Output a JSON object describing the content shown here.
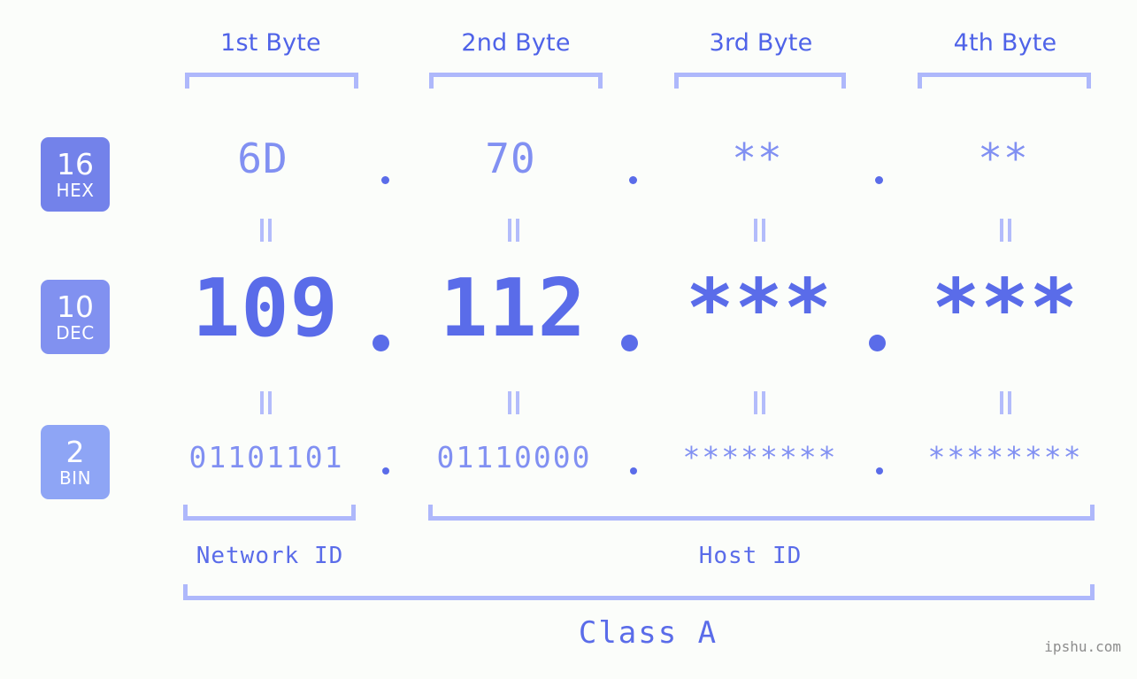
{
  "page": {
    "background_color": "#fbfdfa",
    "accent_color": "#5a6ce9",
    "accent_light_color": "#8190f2",
    "bracket_color": "#aeb8fb",
    "watermark": "ipshu.com"
  },
  "byte_headers": [
    {
      "label": "1st Byte"
    },
    {
      "label": "2nd Byte"
    },
    {
      "label": "3rd Byte"
    },
    {
      "label": "4th Byte"
    }
  ],
  "bases": [
    {
      "number": "16",
      "name": "HEX",
      "color": "#7382ea"
    },
    {
      "number": "10",
      "name": "DEC",
      "color": "#8191f0"
    },
    {
      "number": "2",
      "name": "BIN",
      "color": "#8ea5f5"
    }
  ],
  "rows": {
    "hex": {
      "values": [
        "6D",
        "70",
        "**",
        "**"
      ],
      "separator": "."
    },
    "dec": {
      "values": [
        "109",
        "112",
        "***",
        "***"
      ],
      "separator": "."
    },
    "bin": {
      "values": [
        "01101101",
        "01110000",
        "********",
        "********"
      ],
      "separator": "."
    }
  },
  "equality_symbol": "=",
  "sections": {
    "network_id": "Network ID",
    "host_id": "Host ID",
    "class": "Class A"
  }
}
